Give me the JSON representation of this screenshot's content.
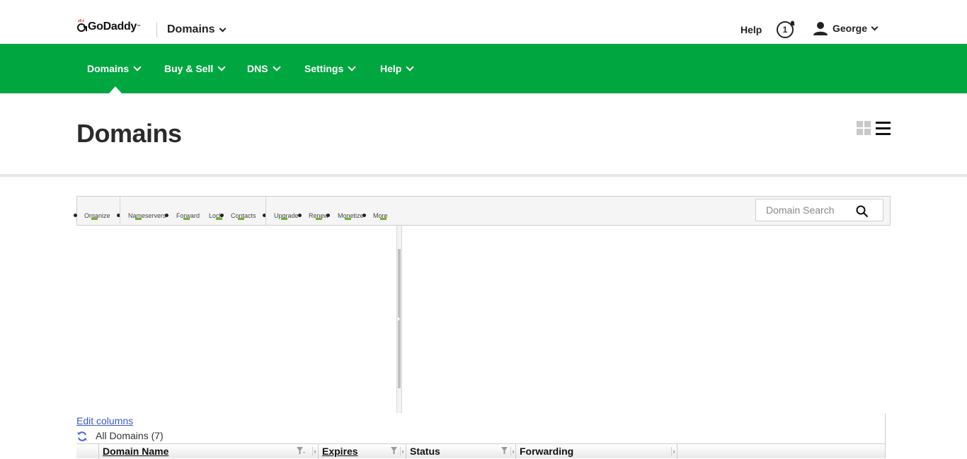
{
  "header": {
    "logo_text": "GoDaddy",
    "logo_tm": "™",
    "product": "Domains",
    "help": "Help",
    "notification_count": "1",
    "user_name": "George"
  },
  "nav": {
    "items": [
      {
        "label": "Domains"
      },
      {
        "label": "Buy & Sell"
      },
      {
        "label": "DNS"
      },
      {
        "label": "Settings"
      },
      {
        "label": "Help"
      }
    ]
  },
  "page": {
    "title": "Domains"
  },
  "toolbar": {
    "items": [
      {
        "label": "Organize"
      },
      {
        "label": "Nameservers"
      },
      {
        "label": "Forward"
      },
      {
        "label": "Lock"
      },
      {
        "label": "Contacts"
      },
      {
        "label": "Upgrade"
      },
      {
        "label": "Renew"
      },
      {
        "label": "Monetize"
      },
      {
        "label": "More"
      }
    ],
    "search_placeholder": "Domain Search"
  },
  "list": {
    "edit_columns": "Edit columns",
    "all_domains": "All Domains (7)",
    "columns": [
      {
        "label": "Domain Name"
      },
      {
        "label": "Expires"
      },
      {
        "label": "Status"
      },
      {
        "label": "Forwarding"
      }
    ]
  },
  "colors": {
    "brand_green": "#00a63f",
    "link_blue": "#3b5bc9"
  }
}
